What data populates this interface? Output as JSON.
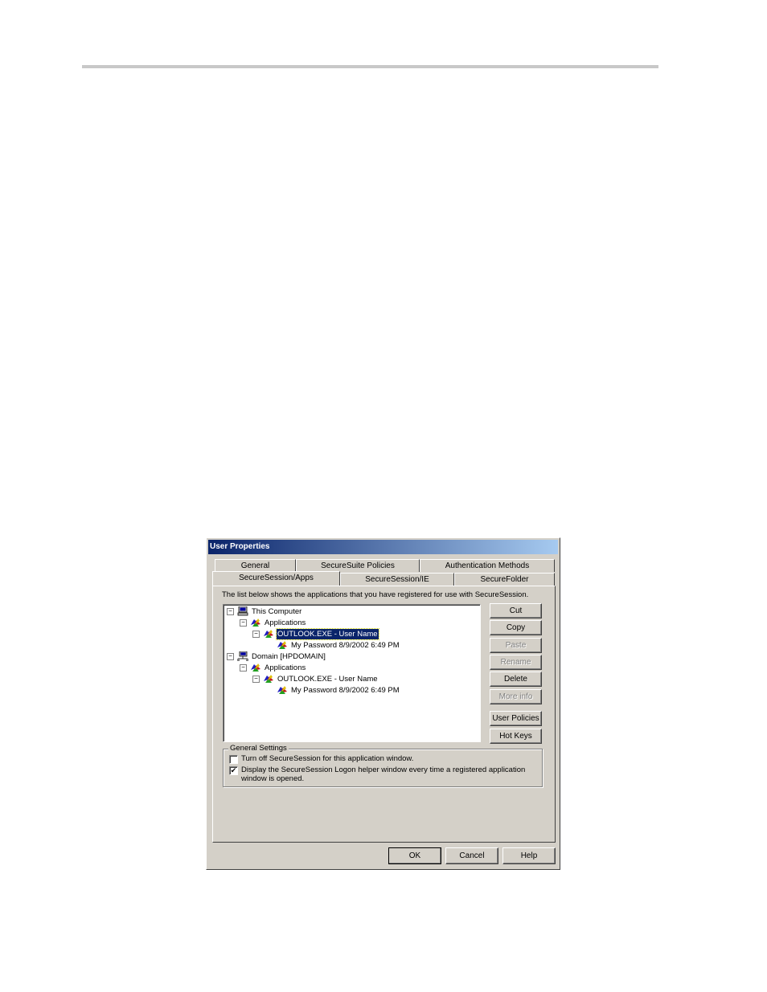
{
  "dialog": {
    "title": "User Properties",
    "tabs_row1": [
      "General",
      "SecureSuite Policies",
      "Authentication Methods"
    ],
    "tabs_row2": [
      "SecureSession/Apps",
      "SecureSession/IE",
      "SecureFolder"
    ],
    "active_tab": "SecureSession/Apps",
    "description": "The list below shows the applications that you have registered for use with SecureSession.",
    "tree": [
      {
        "label": "This Computer",
        "icon": "computer-icon",
        "expander": "−"
      },
      {
        "label": "Applications",
        "icon": "applications-icon",
        "expander": "−"
      },
      {
        "label": "OUTLOOK.EXE - User Name",
        "icon": "application-icon",
        "expander": "−",
        "selected": true
      },
      {
        "label": "My Password  8/9/2002 6:49 PM",
        "icon": "password-icon"
      },
      {
        "label": "Domain [HPDOMAIN]",
        "icon": "domain-icon",
        "expander": "−"
      },
      {
        "label": "Applications",
        "icon": "applications-icon",
        "expander": "−"
      },
      {
        "label": "OUTLOOK.EXE - User Name",
        "icon": "application-icon",
        "expander": "−"
      },
      {
        "label": "My Password  8/9/2002 6:49 PM",
        "icon": "password-icon"
      }
    ],
    "buttons": {
      "cut": "Cut",
      "copy": "Copy",
      "paste": "Paste",
      "rename": "Rename",
      "delete": "Delete",
      "more_info": "More info",
      "user_policies": "User Policies",
      "hot_keys": "Hot Keys"
    },
    "general_settings": {
      "title": "General Settings",
      "turn_off_label": "Turn off SecureSession for this application window.",
      "turn_off_checked": false,
      "display_label": "Display the SecureSession Logon helper window every time a registered application window is opened.",
      "display_checked": true
    },
    "footer": {
      "ok": "OK",
      "cancel": "Cancel",
      "help": "Help"
    },
    "colors": {
      "titlebar_start": "#0a246a",
      "titlebar_end": "#a6caf0",
      "face": "#d4d0c8",
      "selection": "#0a246a"
    }
  }
}
